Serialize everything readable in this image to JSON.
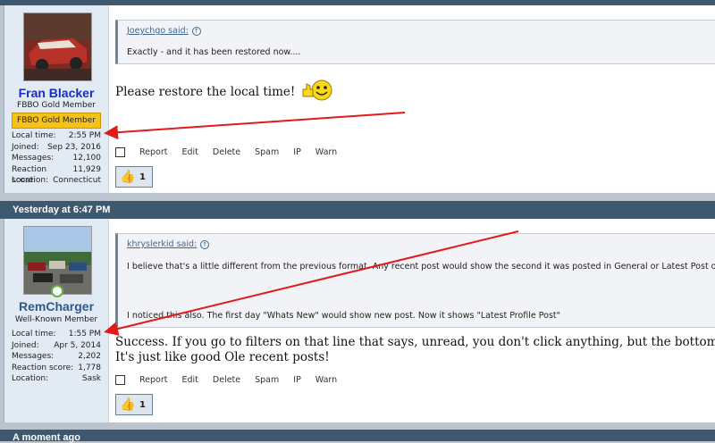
{
  "posts": [
    {
      "username": "Fran Blacker",
      "user_title": "FBBO Gold Member",
      "banner": "FBBO Gold Member",
      "stats": [
        {
          "label": "Local time:",
          "value": "2:55 PM"
        },
        {
          "label": "Joined:",
          "value": "Sep 23, 2016"
        },
        {
          "label": "Messages:",
          "value": "12,100"
        },
        {
          "label": "Reaction score:",
          "value": "11,929"
        },
        {
          "label": "Location:",
          "value": "Connecticut"
        }
      ],
      "quote": {
        "author": "Joeychgo said:",
        "lines": [
          "Exactly - and it has been restored now...."
        ]
      },
      "message": [
        "Please restore the local time!"
      ],
      "actions": [
        "Report",
        "Edit",
        "Delete",
        "Spam",
        "IP",
        "Warn"
      ],
      "likes": "1"
    },
    {
      "header": "Yesterday at 6:47 PM",
      "username": "RemCharger",
      "user_title": "Well-Known Member",
      "stats": [
        {
          "label": "Local time:",
          "value": "1:55 PM"
        },
        {
          "label": "Joined:",
          "value": "Apr 5, 2014"
        },
        {
          "label": "Messages:",
          "value": "2,202"
        },
        {
          "label": "Reaction score:",
          "value": "1,778"
        },
        {
          "label": "Location:",
          "value": "Sask"
        }
      ],
      "quote": {
        "author": "khryslerkid said:",
        "lines": [
          "I believe that's a little different from the previous format. Any recent post would show the second it was posted in General or Latest Post or Home. I g",
          "I noticed this also. The first day \"Whats New\" would show new post. Now it shows \"Latest Profile Post\""
        ]
      },
      "message": [
        "Success. If you go to filters on that line that says, unread, you don't click anything, but the bottom part that says stay this w",
        "It's just like good Ole recent posts!"
      ],
      "actions": [
        "Report",
        "Edit",
        "Delete",
        "Spam",
        "IP",
        "Warn"
      ],
      "likes": "1"
    }
  ],
  "next_header": "A moment ago",
  "colors": {
    "band": "#3e5870",
    "username1": "#1a2fb8",
    "username2": "#2e5a8a",
    "arrow": "#e11a1a",
    "banner": "#f6c217"
  }
}
